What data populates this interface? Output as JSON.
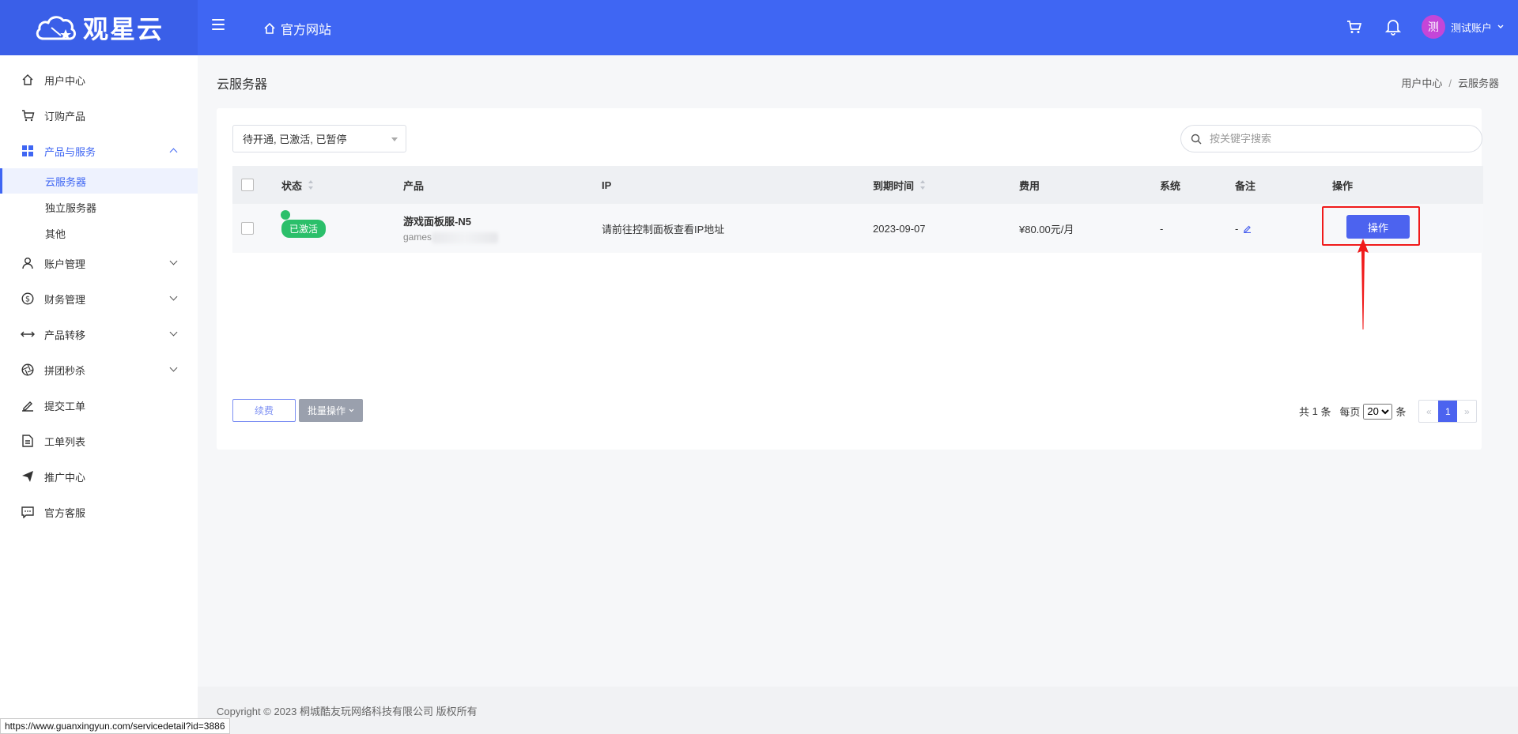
{
  "brand": {
    "name": "观星云"
  },
  "header": {
    "home_link": "官方网站",
    "user": {
      "avatar_initial": "测",
      "name": "测试账户"
    }
  },
  "sidebar": {
    "items": [
      {
        "label": "用户中心",
        "icon": "home-icon"
      },
      {
        "label": "订购产品",
        "icon": "cart-icon"
      },
      {
        "label": "产品与服务",
        "icon": "grid-icon",
        "expanded": true
      },
      {
        "label": "账户管理",
        "icon": "user-icon"
      },
      {
        "label": "财务管理",
        "icon": "dollar-icon"
      },
      {
        "label": "产品转移",
        "icon": "transfer-icon"
      },
      {
        "label": "拼团秒杀",
        "icon": "aperture-icon"
      },
      {
        "label": "提交工单",
        "icon": "edit-icon"
      },
      {
        "label": "工单列表",
        "icon": "document-icon"
      },
      {
        "label": "推广中心",
        "icon": "send-icon"
      },
      {
        "label": "官方客服",
        "icon": "chat-icon"
      }
    ],
    "sub_items": [
      {
        "label": "云服务器",
        "active": true
      },
      {
        "label": "独立服务器"
      },
      {
        "label": "其他"
      }
    ]
  },
  "page": {
    "title": "云服务器",
    "breadcrumb": [
      "用户中心",
      "云服务器"
    ]
  },
  "filters": {
    "status_value": "待开通, 已激活, 已暂停",
    "search_placeholder": "按关键字搜索"
  },
  "table": {
    "columns": [
      "状态",
      "产品",
      "IP",
      "到期时间",
      "费用",
      "系统",
      "备注",
      "操作"
    ],
    "rows": [
      {
        "status": "已激活",
        "product_name": "游戏面板服-N5",
        "product_host": "games",
        "ip": "请前往控制面板查看IP地址",
        "expiry": "2023-09-07",
        "fee": "¥80.00元/月",
        "system": "-",
        "note": "-",
        "action": "操作"
      }
    ]
  },
  "bottom_bar": {
    "renew_label": "续费",
    "batch_label": "批量操作",
    "total_prefix": "共",
    "total_count": "1",
    "total_suffix": "条",
    "per_page_label": "每页",
    "per_page_value": "20",
    "per_page_suffix": "条",
    "prev": "«",
    "current_page": "1",
    "next": "»"
  },
  "footer": {
    "copyright": "Copyright © 2023 桐城酷友玩网络科技有限公司 版权所有"
  },
  "status_bar": {
    "url": "https://www.guanxingyun.com/servicedetail?id=3886"
  },
  "colors": {
    "primary": "#3f66f3",
    "success": "#2bbf6a",
    "highlight": "#f01a1a"
  }
}
